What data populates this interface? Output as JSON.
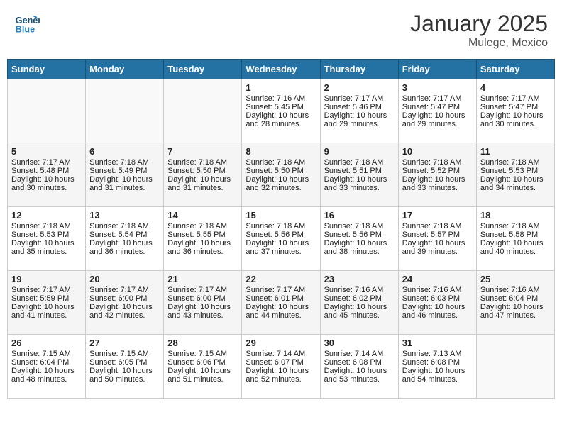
{
  "header": {
    "logo_line1": "General",
    "logo_line2": "Blue",
    "month": "January 2025",
    "location": "Mulege, Mexico"
  },
  "days_of_week": [
    "Sunday",
    "Monday",
    "Tuesday",
    "Wednesday",
    "Thursday",
    "Friday",
    "Saturday"
  ],
  "weeks": [
    [
      {
        "day": "",
        "content": []
      },
      {
        "day": "",
        "content": []
      },
      {
        "day": "",
        "content": []
      },
      {
        "day": "1",
        "content": [
          "Sunrise: 7:16 AM",
          "Sunset: 5:45 PM",
          "Daylight: 10 hours and 28 minutes."
        ]
      },
      {
        "day": "2",
        "content": [
          "Sunrise: 7:17 AM",
          "Sunset: 5:46 PM",
          "Daylight: 10 hours and 29 minutes."
        ]
      },
      {
        "day": "3",
        "content": [
          "Sunrise: 7:17 AM",
          "Sunset: 5:47 PM",
          "Daylight: 10 hours and 29 minutes."
        ]
      },
      {
        "day": "4",
        "content": [
          "Sunrise: 7:17 AM",
          "Sunset: 5:47 PM",
          "Daylight: 10 hours and 30 minutes."
        ]
      }
    ],
    [
      {
        "day": "5",
        "content": [
          "Sunrise: 7:17 AM",
          "Sunset: 5:48 PM",
          "Daylight: 10 hours and 30 minutes."
        ]
      },
      {
        "day": "6",
        "content": [
          "Sunrise: 7:18 AM",
          "Sunset: 5:49 PM",
          "Daylight: 10 hours and 31 minutes."
        ]
      },
      {
        "day": "7",
        "content": [
          "Sunrise: 7:18 AM",
          "Sunset: 5:50 PM",
          "Daylight: 10 hours and 31 minutes."
        ]
      },
      {
        "day": "8",
        "content": [
          "Sunrise: 7:18 AM",
          "Sunset: 5:50 PM",
          "Daylight: 10 hours and 32 minutes."
        ]
      },
      {
        "day": "9",
        "content": [
          "Sunrise: 7:18 AM",
          "Sunset: 5:51 PM",
          "Daylight: 10 hours and 33 minutes."
        ]
      },
      {
        "day": "10",
        "content": [
          "Sunrise: 7:18 AM",
          "Sunset: 5:52 PM",
          "Daylight: 10 hours and 33 minutes."
        ]
      },
      {
        "day": "11",
        "content": [
          "Sunrise: 7:18 AM",
          "Sunset: 5:53 PM",
          "Daylight: 10 hours and 34 minutes."
        ]
      }
    ],
    [
      {
        "day": "12",
        "content": [
          "Sunrise: 7:18 AM",
          "Sunset: 5:53 PM",
          "Daylight: 10 hours and 35 minutes."
        ]
      },
      {
        "day": "13",
        "content": [
          "Sunrise: 7:18 AM",
          "Sunset: 5:54 PM",
          "Daylight: 10 hours and 36 minutes."
        ]
      },
      {
        "day": "14",
        "content": [
          "Sunrise: 7:18 AM",
          "Sunset: 5:55 PM",
          "Daylight: 10 hours and 36 minutes."
        ]
      },
      {
        "day": "15",
        "content": [
          "Sunrise: 7:18 AM",
          "Sunset: 5:56 PM",
          "Daylight: 10 hours and 37 minutes."
        ]
      },
      {
        "day": "16",
        "content": [
          "Sunrise: 7:18 AM",
          "Sunset: 5:56 PM",
          "Daylight: 10 hours and 38 minutes."
        ]
      },
      {
        "day": "17",
        "content": [
          "Sunrise: 7:18 AM",
          "Sunset: 5:57 PM",
          "Daylight: 10 hours and 39 minutes."
        ]
      },
      {
        "day": "18",
        "content": [
          "Sunrise: 7:18 AM",
          "Sunset: 5:58 PM",
          "Daylight: 10 hours and 40 minutes."
        ]
      }
    ],
    [
      {
        "day": "19",
        "content": [
          "Sunrise: 7:17 AM",
          "Sunset: 5:59 PM",
          "Daylight: 10 hours and 41 minutes."
        ]
      },
      {
        "day": "20",
        "content": [
          "Sunrise: 7:17 AM",
          "Sunset: 6:00 PM",
          "Daylight: 10 hours and 42 minutes."
        ]
      },
      {
        "day": "21",
        "content": [
          "Sunrise: 7:17 AM",
          "Sunset: 6:00 PM",
          "Daylight: 10 hours and 43 minutes."
        ]
      },
      {
        "day": "22",
        "content": [
          "Sunrise: 7:17 AM",
          "Sunset: 6:01 PM",
          "Daylight: 10 hours and 44 minutes."
        ]
      },
      {
        "day": "23",
        "content": [
          "Sunrise: 7:16 AM",
          "Sunset: 6:02 PM",
          "Daylight: 10 hours and 45 minutes."
        ]
      },
      {
        "day": "24",
        "content": [
          "Sunrise: 7:16 AM",
          "Sunset: 6:03 PM",
          "Daylight: 10 hours and 46 minutes."
        ]
      },
      {
        "day": "25",
        "content": [
          "Sunrise: 7:16 AM",
          "Sunset: 6:04 PM",
          "Daylight: 10 hours and 47 minutes."
        ]
      }
    ],
    [
      {
        "day": "26",
        "content": [
          "Sunrise: 7:15 AM",
          "Sunset: 6:04 PM",
          "Daylight: 10 hours and 48 minutes."
        ]
      },
      {
        "day": "27",
        "content": [
          "Sunrise: 7:15 AM",
          "Sunset: 6:05 PM",
          "Daylight: 10 hours and 50 minutes."
        ]
      },
      {
        "day": "28",
        "content": [
          "Sunrise: 7:15 AM",
          "Sunset: 6:06 PM",
          "Daylight: 10 hours and 51 minutes."
        ]
      },
      {
        "day": "29",
        "content": [
          "Sunrise: 7:14 AM",
          "Sunset: 6:07 PM",
          "Daylight: 10 hours and 52 minutes."
        ]
      },
      {
        "day": "30",
        "content": [
          "Sunrise: 7:14 AM",
          "Sunset: 6:08 PM",
          "Daylight: 10 hours and 53 minutes."
        ]
      },
      {
        "day": "31",
        "content": [
          "Sunrise: 7:13 AM",
          "Sunset: 6:08 PM",
          "Daylight: 10 hours and 54 minutes."
        ]
      },
      {
        "day": "",
        "content": []
      }
    ]
  ]
}
